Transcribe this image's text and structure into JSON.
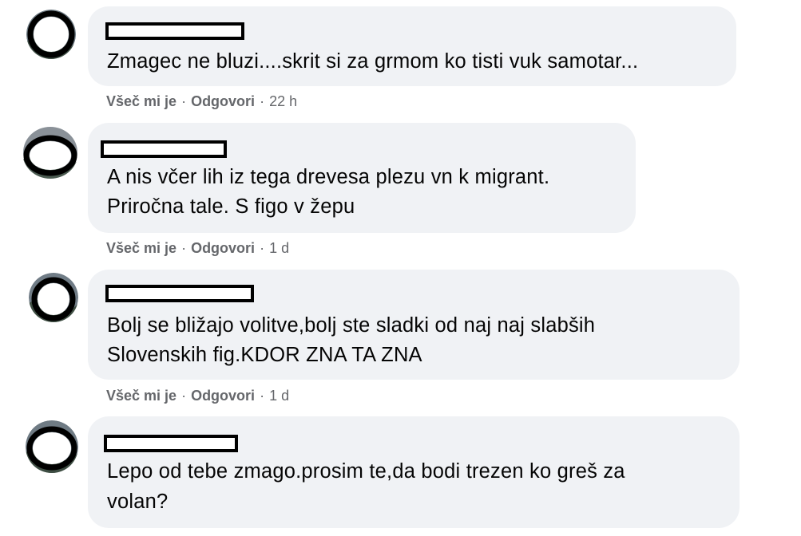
{
  "comments": [
    {
      "text_lines": [
        "Zmagec ne bluzi....skrit si za grmom ko tisti vuk samotar..."
      ],
      "like_label": "Všeč mi je",
      "separator": "·",
      "reply_label": "Odgovori",
      "time": "22 h"
    },
    {
      "text_lines": [
        "A nis včer lih iz tega drevesa plezu vn k migrant.",
        "Priročna tale. S figo v žepu"
      ],
      "like_label": "Všeč mi je",
      "separator": "·",
      "reply_label": "Odgovori",
      "time": "1 d"
    },
    {
      "text_lines": [
        "Bolj se bližajo volitve,bolj ste sladki od naj naj slabših",
        "Slovenskih fig.KDOR ZNA TA ZNA"
      ],
      "like_label": "Všeč mi je",
      "separator": "·",
      "reply_label": "Odgovori",
      "time": "1 d"
    },
    {
      "text_lines": [
        "Lepo od tebe zmago.prosim te,da bodi trezen ko greš za",
        "volan?"
      ]
    }
  ],
  "colors": {
    "bubble": "#f0f2f5",
    "text": "#050505",
    "meta": "#65676b",
    "redaction": "#000000"
  },
  "icons": {
    "avatar": "redacted-profile-avatar"
  }
}
